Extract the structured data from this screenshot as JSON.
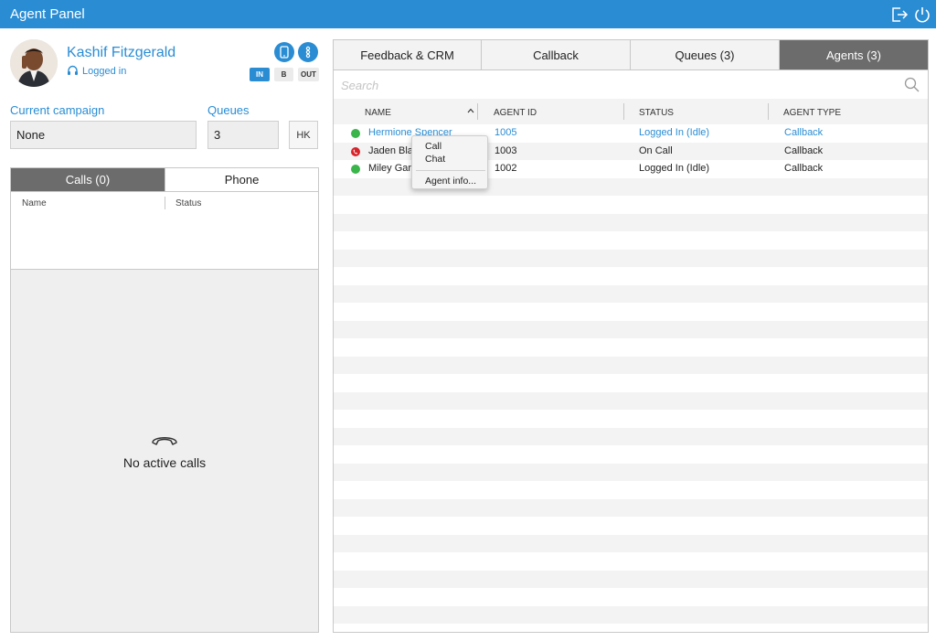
{
  "window": {
    "title": "Agent Panel"
  },
  "agent": {
    "name": "Kashif Fitzgerald",
    "status": "Logged in"
  },
  "modes": {
    "in": "IN",
    "b": "B",
    "out": "OUT"
  },
  "campaign": {
    "label": "Current campaign",
    "value": "None"
  },
  "queues": {
    "label": "Queues",
    "value": "3",
    "hk_label": "HK"
  },
  "left_tabs": {
    "calls": "Calls (0)",
    "phone": "Phone"
  },
  "calls_table": {
    "col_name": "Name",
    "col_status": "Status",
    "empty_text": "No active calls"
  },
  "right_tabs": [
    {
      "label": "Feedback & CRM"
    },
    {
      "label": "Callback"
    },
    {
      "label": "Queues (3)"
    },
    {
      "label": "Agents (3)"
    }
  ],
  "search": {
    "placeholder": "Search"
  },
  "agents_table": {
    "columns": {
      "name": "NAME",
      "agent_id": "AGENT ID",
      "status": "STATUS",
      "agent_type": "AGENT TYPE"
    },
    "rows": [
      {
        "name": "Hermione Spencer",
        "agent_id": "1005",
        "status": "Logged In (Idle)",
        "agent_type": "Callback",
        "indicator": "idle"
      },
      {
        "name": "Jaden Bla",
        "agent_id": "1003",
        "status": "On Call",
        "agent_type": "Callback",
        "indicator": "on-call"
      },
      {
        "name": "Miley Garr",
        "agent_id": "1002",
        "status": "Logged In (Idle)",
        "agent_type": "Callback",
        "indicator": "idle"
      }
    ]
  },
  "context_menu": {
    "call": "Call",
    "chat": "Chat",
    "agent_info": "Agent info..."
  },
  "colors": {
    "accent": "#2a8dd4",
    "active_tab": "#6c6c6c",
    "idle": "#3ab54a",
    "on_call": "#d8232a"
  },
  "icons": [
    "logout-icon",
    "power-icon",
    "headset-icon",
    "phone-device-icon",
    "info-icon",
    "sort-icon",
    "search-icon",
    "hangup-icon"
  ]
}
